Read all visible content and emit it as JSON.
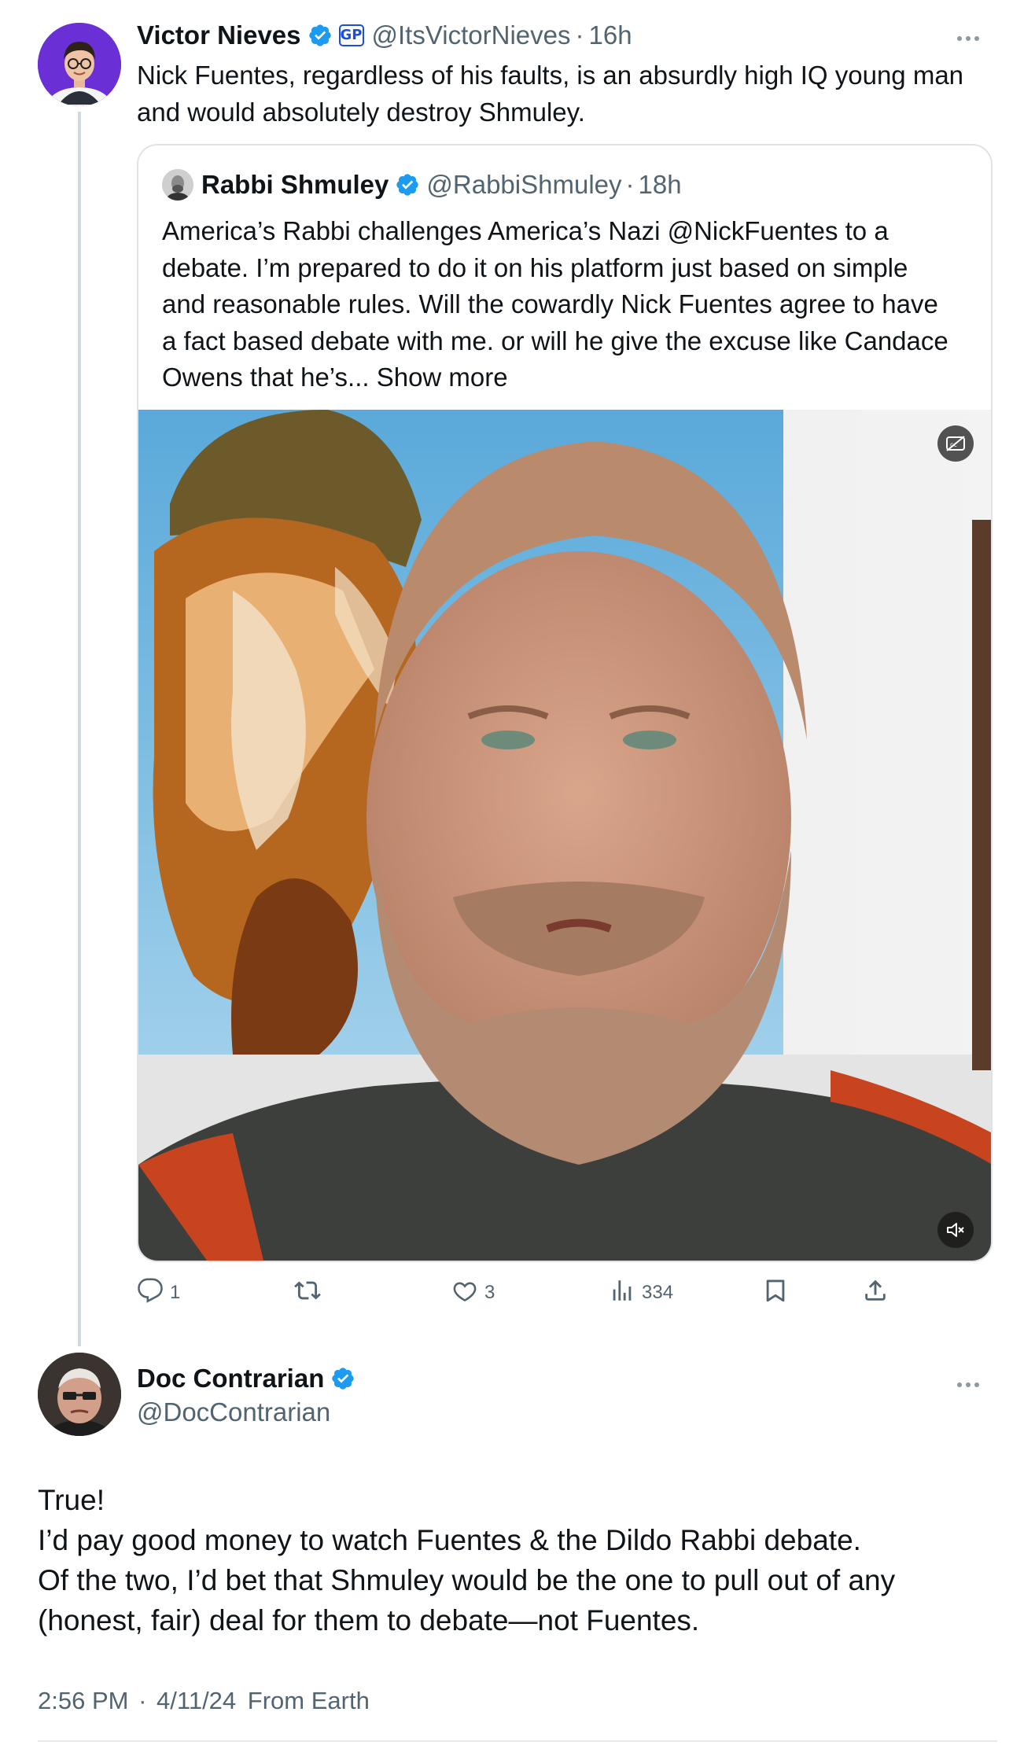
{
  "colors": {
    "text_primary": "#0f1419",
    "text_secondary": "#536471",
    "verified_blue": "#1d9bf0",
    "border": "#dfe3e7",
    "thread_line": "#cfd9de"
  },
  "tweet_main": {
    "author_name": "Victor Nieves",
    "affiliate_badge": "GP",
    "handle": "@ItsVictorNieves",
    "separator": "·",
    "time": "16h",
    "text_lines": [
      "Nick Fuentes, regardless of his faults, is an absurdly high IQ young man",
      "and would absolutely destroy Shmuley."
    ],
    "more_icon": "more-horizontal-icon"
  },
  "quoted_tweet": {
    "author_name": "Rabbi Shmuley",
    "handle": "@RabbiShmuley",
    "separator": "·",
    "time": "18h",
    "text_lines": [
      "America’s Rabbi challenges America’s Nazi @NickFuentes to a",
      "debate. I’m prepared to do it on his platform just based on simple",
      "and reasonable rules. Will the cowardly Nick Fuentes agree to have",
      "a fact based debate with me. or will he give the excuse like Candace",
      "Owens that he’s..."
    ],
    "show_more": "Show more",
    "media": {
      "type": "video",
      "captions_icon": "captions-icon",
      "mute_icon": "muted-speaker-icon"
    }
  },
  "actions": {
    "replies": "1",
    "reposts": "",
    "likes": "3",
    "views": "334",
    "icons": [
      "reply-icon",
      "repost-icon",
      "like-icon",
      "views-icon",
      "bookmark-icon",
      "share-icon"
    ]
  },
  "tweet_reply": {
    "author_name": "Doc Contrarian",
    "handle": "@DocContrarian",
    "text_lines": [
      "True!",
      "I’d pay good money to watch Fuentes & the Dildo Rabbi debate.",
      "Of the two, I’d bet that Shmuley would be the one to pull out of any",
      "(honest, fair) deal for them to debate—not Fuentes."
    ],
    "time": "2:56 PM",
    "separator": "·",
    "date": "4/11/24",
    "source": "From Earth",
    "more_icon": "more-horizontal-icon"
  }
}
